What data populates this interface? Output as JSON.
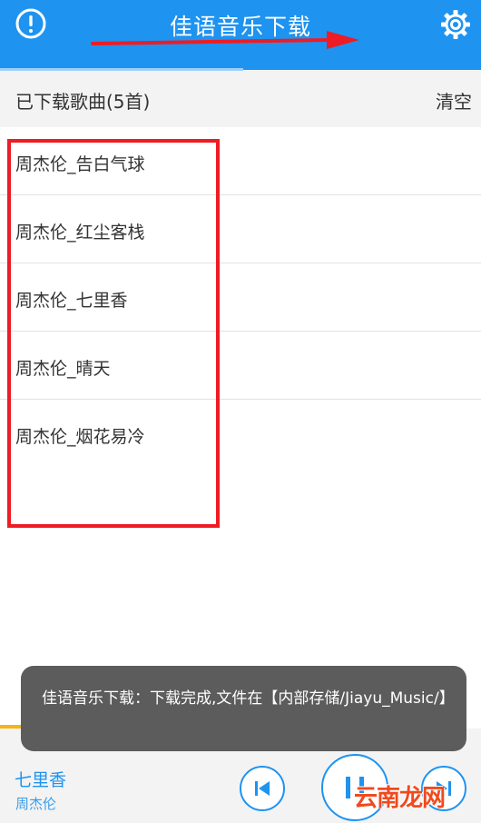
{
  "header": {
    "title": "佳语音乐下载"
  },
  "subbar": {
    "count_label": "已下载歌曲(5首)",
    "clear_label": "清空"
  },
  "songs": [
    "周杰伦_告白气球",
    "周杰伦_红尘客栈",
    "周杰伦_七里香",
    "周杰伦_晴天",
    "周杰伦_烟花易冷"
  ],
  "toast": {
    "text": "佳语音乐下载：下载完成,文件在【内部存储/Jiayu_Music/】"
  },
  "player": {
    "title": "七里香",
    "artist": "周杰伦"
  },
  "watermark": "云南龙网",
  "colors": {
    "accent": "#1e93f0",
    "annotation": "#ee1c24",
    "toast_bg": "#5c5c5c"
  },
  "icons": [
    "info-icon",
    "gear-icon",
    "previous-icon",
    "pause-icon",
    "next-icon"
  ]
}
